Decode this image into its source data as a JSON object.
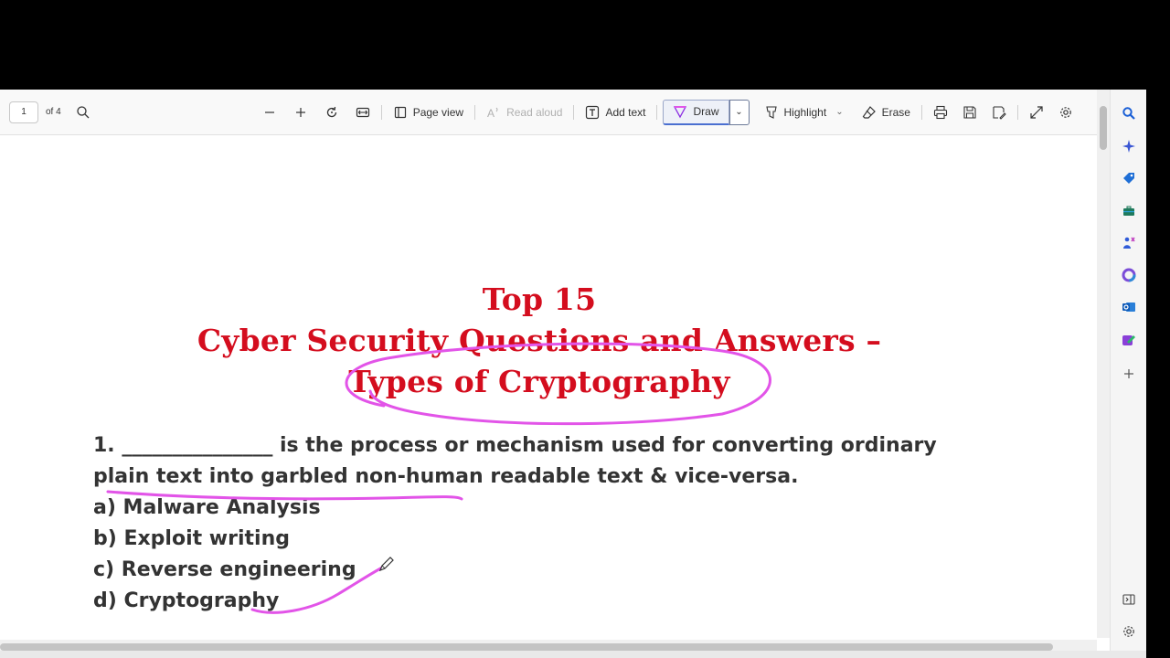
{
  "toolbar": {
    "page_number": "1",
    "page_total": "of 4",
    "page_view_label": "Page view",
    "read_aloud_label": "Read aloud",
    "add_text_label": "Add text",
    "draw_label": "Draw",
    "highlight_label": "Highlight",
    "erase_label": "Erase"
  },
  "document": {
    "title_line1": "Top 15",
    "title_line2": "Cyber Security Questions and Answers –",
    "title_line3": "Types of Cryptography",
    "question_line1": "1. _______________ is the process or mechanism used for converting ordinary",
    "question_line2": "plain text into garbled non-human readable text & vice-versa.",
    "option_a": "a) Malware Analysis",
    "option_b": "b) Exploit writing",
    "option_c": "c) Reverse engineering",
    "option_d": "d) Cryptography"
  },
  "colors": {
    "title_red": "#d40d1e",
    "ink_pink": "#e254e8",
    "body_text": "#333333"
  },
  "sidebar_icons": [
    "search-icon",
    "copilot-icon",
    "shopping-tag-icon",
    "toolbox-icon",
    "games-icon",
    "office-icon",
    "outlook-icon",
    "designer-icon",
    "add-icon",
    "split-screen-icon",
    "settings-icon"
  ]
}
